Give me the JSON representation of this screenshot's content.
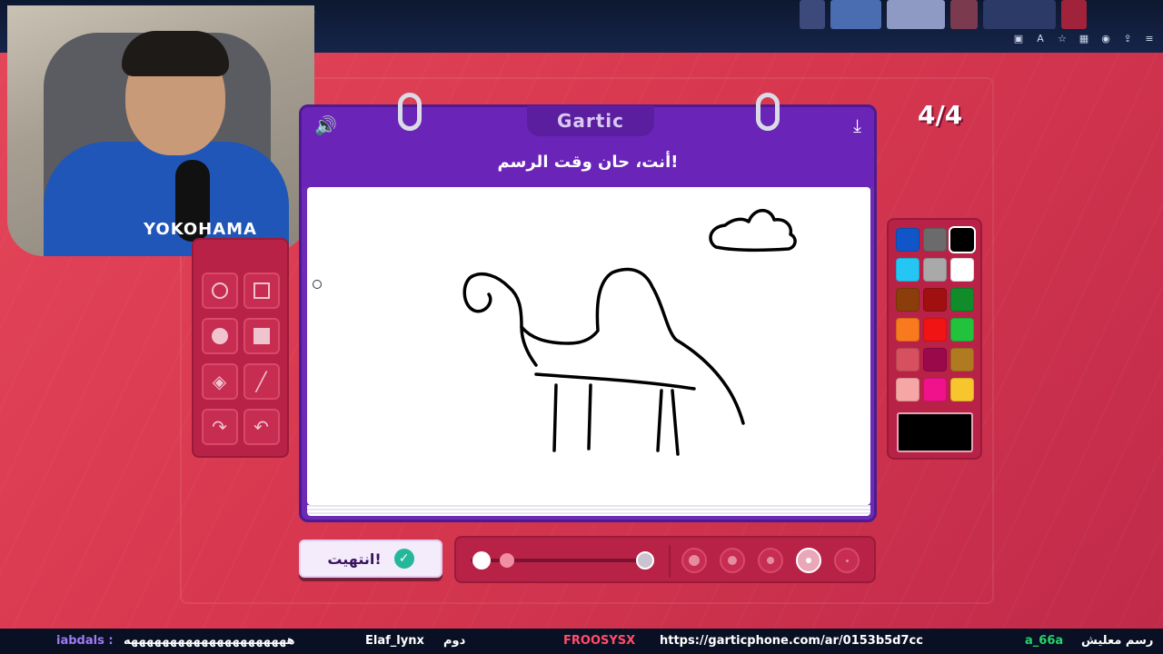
{
  "browser": {
    "new_tab_symbol": "+"
  },
  "header": {
    "logo": "Gartic",
    "instruction": "أنت، حان وقت الرسم!"
  },
  "webcam": {
    "shirt_text": "YOKOHAMA"
  },
  "round_counter": "4/4",
  "done_button": {
    "label": "انتهيت!"
  },
  "palette": {
    "colors": [
      "#1156c9",
      "#6b6b6b",
      "#000000",
      "#26c6f4",
      "#a9a9a9",
      "#ffffff",
      "#8b3e0c",
      "#a01010",
      "#118c2a",
      "#f97a1e",
      "#f01414",
      "#22c23c",
      "#d6505f",
      "#9a0a4a",
      "#b07a20",
      "#f7a6a6",
      "#f0128a",
      "#f7c62f"
    ],
    "selected_color": "#000000"
  },
  "stroke": {
    "sizes_count": 5,
    "selected_size_index": 3
  },
  "stream_bar": {
    "items": [
      "iabdals :",
      "هههههههههههههههههههههه",
      "Elaf_lynx",
      "دوم",
      "FROOSYSX",
      "https://garticphone.com/ar/0153b5d7cc",
      "a_66a",
      "رسم معليش"
    ]
  }
}
